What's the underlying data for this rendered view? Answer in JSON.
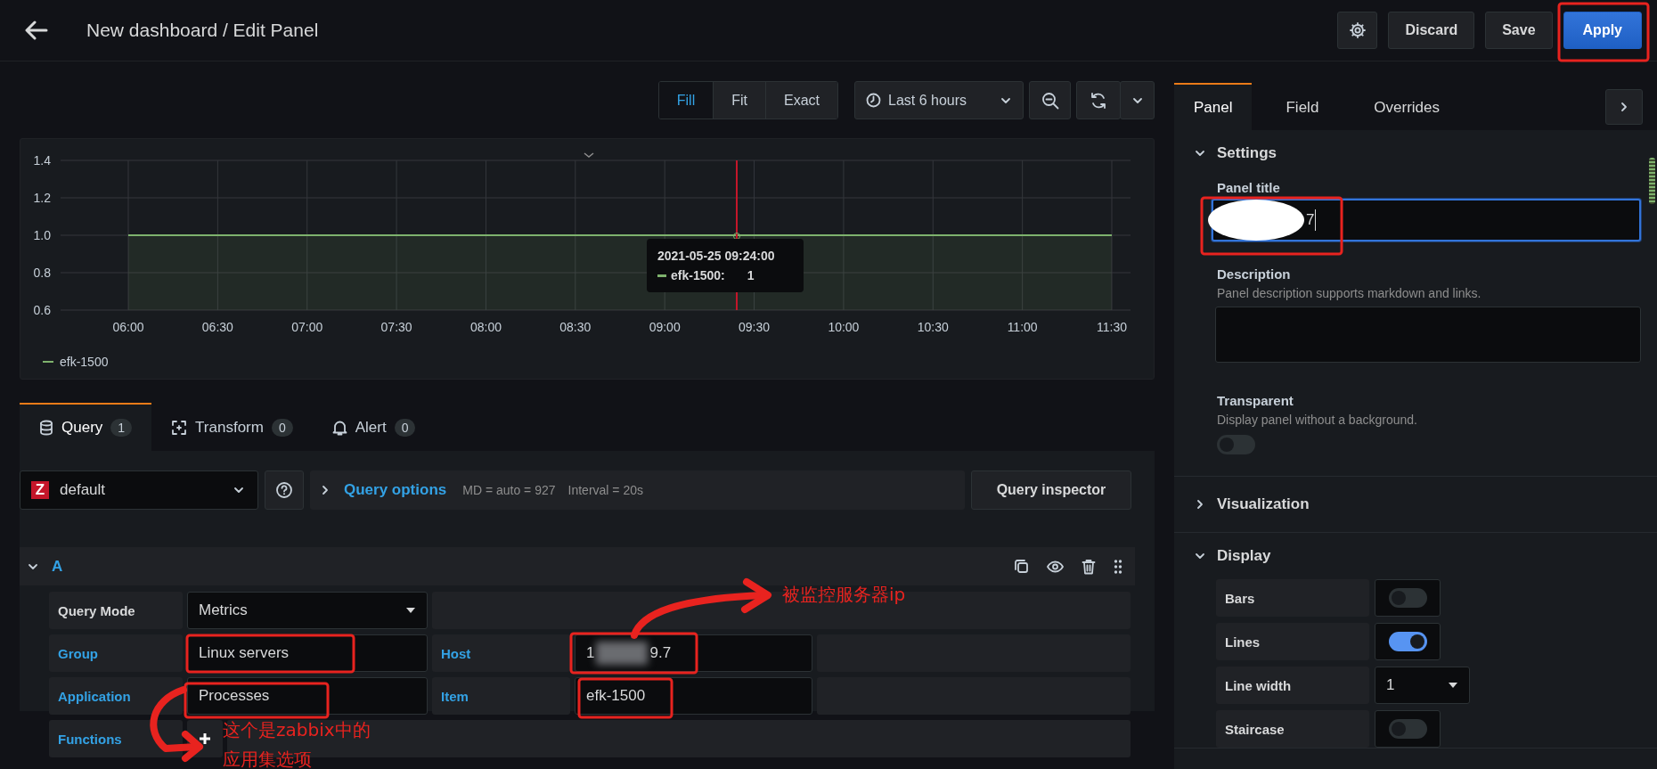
{
  "header": {
    "title": "New dashboard / Edit Panel",
    "buttons": [
      {
        "label": "Discard",
        "kind": "secondary"
      },
      {
        "label": "Save",
        "kind": "secondary"
      },
      {
        "label": "Apply",
        "kind": "primary"
      }
    ]
  },
  "toolbar": {
    "fit_modes": [
      {
        "label": "Fill",
        "selected": true
      },
      {
        "label": "Fit",
        "selected": false
      },
      {
        "label": "Exact",
        "selected": false
      }
    ],
    "time_range": "Last 6 hours"
  },
  "chart": {
    "chart_data": {
      "type": "area",
      "grid": true,
      "categories": [
        "06:00",
        "06:30",
        "07:00",
        "07:30",
        "08:00",
        "08:30",
        "09:00",
        "09:30",
        "10:00",
        "10:30",
        "11:00",
        "11:30"
      ],
      "series": [
        {
          "name": "efk-1500",
          "color": "#7eb26d",
          "values": [
            1,
            1,
            1,
            1,
            1,
            1,
            1,
            1,
            1,
            1,
            1,
            1
          ]
        }
      ],
      "ylim": [
        0.6,
        1.4
      ],
      "yticks": [
        {
          "value": 0.6,
          "label": "0.6"
        },
        {
          "value": 0.8,
          "label": "0.8"
        },
        {
          "value": 1,
          "label": "1.0"
        },
        {
          "value": 1.2,
          "label": "1.2"
        },
        {
          "value": 1.4,
          "label": "1.4"
        }
      ]
    },
    "tooltip": {
      "time": "2021-05-25 09:24:00",
      "series": "efk-1500:",
      "value": "1"
    }
  },
  "editor_tabs": [
    {
      "label": "Query",
      "count": "1",
      "selected": true
    },
    {
      "label": "Transform",
      "count": "0",
      "selected": false
    },
    {
      "label": "Alert",
      "count": "0",
      "selected": false
    }
  ],
  "query_bar": {
    "datasource_logo": "Z",
    "datasource": "default",
    "options_label": "Query options",
    "max_data_points": "MD = auto = 927",
    "interval": "Interval = 20s",
    "inspector": "Query inspector"
  },
  "query": {
    "ref": "A",
    "expanded": true,
    "rows": [
      {
        "cells": [
          {
            "kind": "heading",
            "text": "Query Mode"
          },
          {
            "kind": "select",
            "value": "Metrics"
          }
        ]
      },
      {
        "cells": [
          {
            "kind": "label",
            "text": "Group"
          },
          {
            "kind": "input",
            "value": "Linux servers"
          },
          {
            "kind": "label",
            "text": "Host"
          },
          {
            "kind": "input",
            "value": "1",
            "redacted": true,
            "value_tail": "9.7"
          }
        ]
      },
      {
        "cells": [
          {
            "kind": "label",
            "text": "Application"
          },
          {
            "kind": "input",
            "value": "Processes"
          },
          {
            "kind": "label",
            "text": "Item"
          },
          {
            "kind": "input",
            "value": "efk-1500"
          }
        ]
      },
      {
        "cells": [
          {
            "kind": "label",
            "text": "Functions"
          },
          {
            "kind": "add"
          }
        ]
      }
    ]
  },
  "options_pane": {
    "tabs": [
      {
        "label": "Panel",
        "selected": true
      },
      {
        "label": "Field",
        "selected": false
      },
      {
        "label": "Overrides",
        "selected": false
      }
    ],
    "sections": [
      {
        "title": "Settings",
        "expanded": true,
        "fields": [
          {
            "kind": "text",
            "label": "Panel title",
            "value": "7",
            "redacted": true,
            "focused": true
          },
          {
            "kind": "textarea",
            "label": "Description",
            "description": "Panel description supports markdown and links."
          },
          {
            "kind": "switch",
            "label": "Transparent",
            "description": "Display panel without a background.",
            "on": false
          }
        ]
      },
      {
        "title": "Visualization",
        "expanded": false
      },
      {
        "title": "Display",
        "expanded": true,
        "rows": [
          {
            "kind": "switch",
            "label": "Bars",
            "on": false
          },
          {
            "kind": "switch",
            "label": "Lines",
            "on": true
          },
          {
            "kind": "select",
            "label": "Line width",
            "value": "1"
          },
          {
            "kind": "switch",
            "label": "Staircase",
            "on": false
          }
        ]
      }
    ]
  },
  "annotations": [
    {
      "kind": "note",
      "text": "被监控服务器ip"
    },
    {
      "kind": "note",
      "text": "这个是zabbix中的"
    },
    {
      "kind": "note",
      "text": "应用集选项"
    }
  ]
}
